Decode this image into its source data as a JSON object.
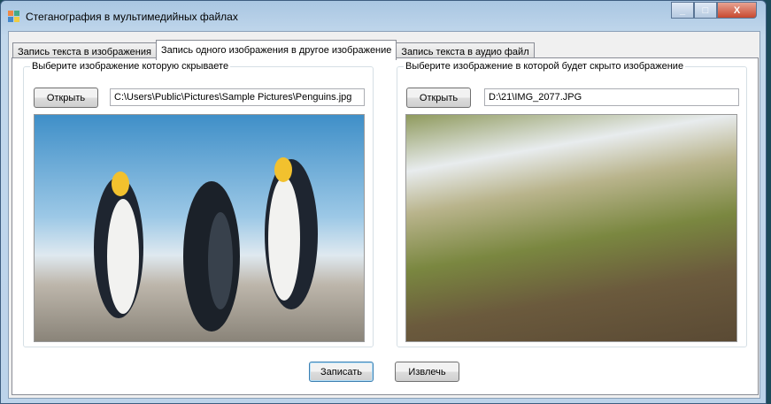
{
  "window": {
    "title": "Стеганография в мультимедийных файлах",
    "close": "X"
  },
  "tabs": [
    {
      "label": "Запись текста в изображения"
    },
    {
      "label": "Запись одного изображения в другое изображение"
    },
    {
      "label": "Запись текста в аудио файл"
    }
  ],
  "left": {
    "legend": "Выберите изображение которую скрываете",
    "open": "Открыть",
    "path": "C:\\Users\\Public\\Pictures\\Sample Pictures\\Penguins.jpg"
  },
  "right": {
    "legend": "Выберите изображение в которой будет скрыто изображение",
    "open": "Открыть",
    "path": "D:\\21\\IMG_2077.JPG"
  },
  "actions": {
    "write": "Записать",
    "extract": "Извлечь"
  }
}
